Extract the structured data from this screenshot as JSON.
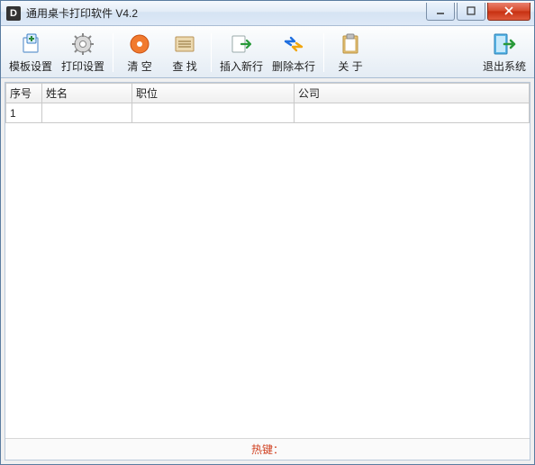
{
  "window": {
    "app_icon_letter": "D",
    "title": "通用桌卡打印软件   V4.2"
  },
  "toolbar": {
    "template_settings": "模板设置",
    "print_settings": "打印设置",
    "clear": "清   空",
    "find": "查   找",
    "insert_row": "插入新行",
    "delete_row": "删除本行",
    "about": "关   于",
    "exit": "退出系统"
  },
  "table": {
    "headers": {
      "index": "序号",
      "name": "姓名",
      "position": "职位",
      "company": "公司"
    },
    "rows": [
      {
        "index": "1",
        "name": "",
        "position": "",
        "company": ""
      }
    ]
  },
  "footer": {
    "hotkeys_label": "热键："
  }
}
